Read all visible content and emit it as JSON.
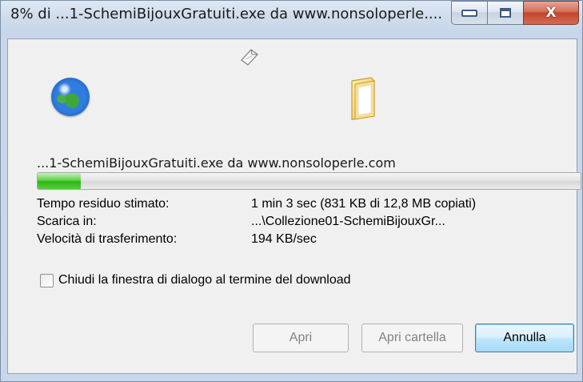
{
  "window": {
    "title": "8% di ...1-SchemiBijouxGratuiti.exe da www.nonsoloperle....",
    "minimize_icon": "minimize-icon",
    "maximize_icon": "maximize-icon",
    "close_icon": "close-icon",
    "close_glyph": "X"
  },
  "animation": {
    "source_icon": "globe-icon",
    "flying_icon": "document-icon",
    "target_icon": "folder-icon"
  },
  "download": {
    "file_label": "...1-SchemiBijouxGratuiti.exe da www.nonsoloperle.com",
    "progress_percent": 8,
    "rows": [
      {
        "label": "Tempo residuo stimato:",
        "value": "1 min 3 sec (831 KB di 12,8 MB copiati)"
      },
      {
        "label": "Scarica in:",
        "value": "...\\Collezione01-SchemiBijouxGr..."
      },
      {
        "label": "Velocità di trasferimento:",
        "value": "194 KB/sec"
      }
    ]
  },
  "options": {
    "close_on_complete_label": "Chiudi la finestra di dialogo al termine del download",
    "close_on_complete_checked": false
  },
  "buttons": {
    "open": "Apri",
    "open_folder": "Apri cartella",
    "cancel": "Annulla"
  },
  "colors": {
    "progress_green": "#2fb514",
    "close_red": "#c2452c",
    "default_button_blue": "#3c7fb1"
  }
}
